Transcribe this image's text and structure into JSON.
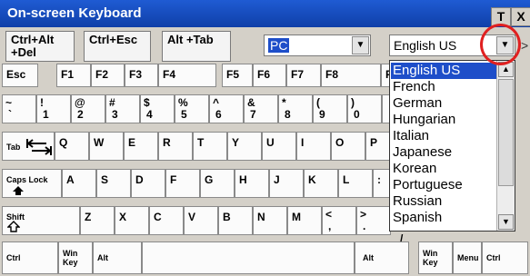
{
  "window": {
    "title": "On-screen Keyboard"
  },
  "titlebar_buttons": [
    "T",
    "X"
  ],
  "toolbar": {
    "ctrl_alt_del": "Ctrl+Alt +Del",
    "ctrl_esc": "Ctrl+Esc",
    "alt_tab": "Alt +Tab",
    "platform_value": "PC",
    "language_value": "English US",
    "right_edge": ">"
  },
  "language_options": [
    "English US",
    "French",
    "German",
    "Hungarian",
    "Italian",
    "Japanese",
    "Korean",
    "Portuguese",
    "Russian",
    "Spanish"
  ],
  "selected_language": "English US",
  "keys": {
    "esc": "Esc",
    "f1": "F1",
    "f2": "F2",
    "f3": "F3",
    "f4": "F4",
    "f5": "F5",
    "f6": "F6",
    "f7": "F7",
    "f8": "F8",
    "f_partial": "F",
    "row2": [
      {
        "top": "~",
        "bottom": "`"
      },
      {
        "top": "!",
        "bottom": "1"
      },
      {
        "top": "@",
        "bottom": "2"
      },
      {
        "top": "#",
        "bottom": "3"
      },
      {
        "top": "$",
        "bottom": "4"
      },
      {
        "top": "%",
        "bottom": "5"
      },
      {
        "top": "^",
        "bottom": "6"
      },
      {
        "top": "&",
        "bottom": "7"
      },
      {
        "top": "*",
        "bottom": "8"
      },
      {
        "top": "(",
        "bottom": "9"
      },
      {
        "top": ")",
        "bottom": "0"
      }
    ],
    "tab": "Tab",
    "row3": [
      "Q",
      "W",
      "E",
      "R",
      "T",
      "Y",
      "U",
      "I",
      "O",
      "P"
    ],
    "caps": "Caps Lock",
    "row4": [
      "A",
      "S",
      "D",
      "F",
      "G",
      "H",
      "J",
      "K",
      "L"
    ],
    "row4_partial": ":",
    "shift": "Shift",
    "row5": [
      "Z",
      "X",
      "C",
      "V",
      "B",
      "N",
      "M"
    ],
    "lt": {
      "top": "<",
      "bottom": ","
    },
    "gt": {
      "top": ">",
      "bottom": "."
    },
    "slash_partial": "/",
    "ctrl": "Ctrl",
    "win": "Win Key",
    "alt": "Alt",
    "alt_r": "Alt",
    "win_r": "Win Key",
    "menu": "Menu",
    "ctrl_r": "Ctrl"
  }
}
